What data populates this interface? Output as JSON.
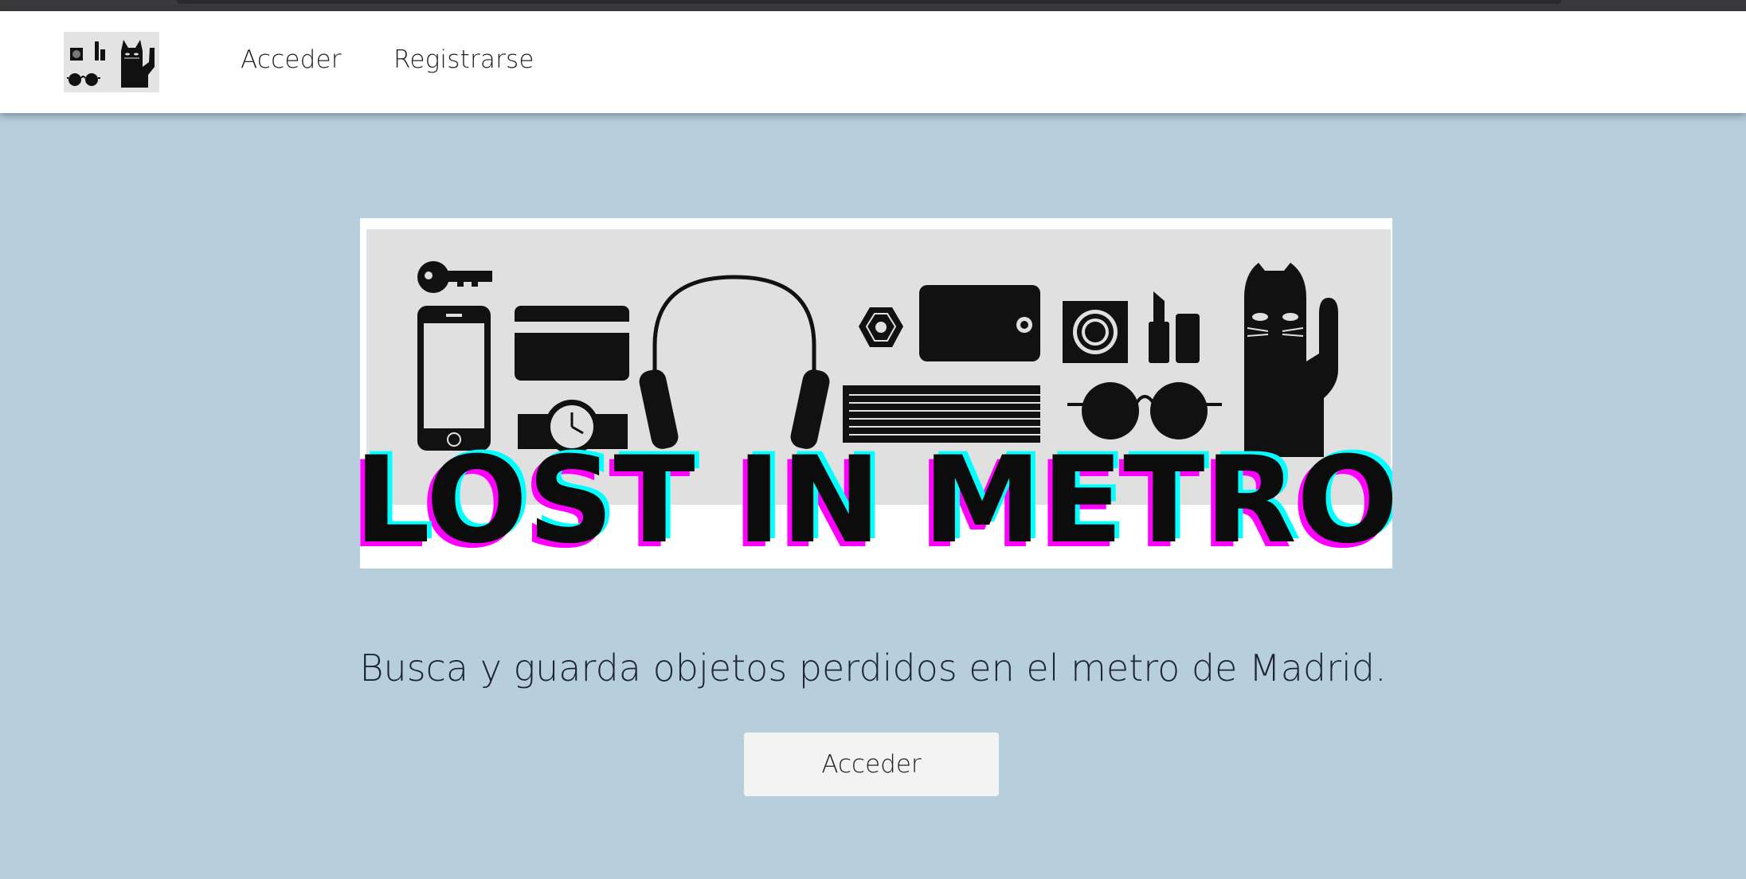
{
  "nav": {
    "logo_alt": "Lost in Metro logo",
    "links": [
      {
        "label": "Acceder"
      },
      {
        "label": "Registrarse"
      }
    ]
  },
  "hero": {
    "banner_title": "LOST IN METRO",
    "tagline": "Busca y guarda objetos perdidos en el metro de Madrid.",
    "cta_label": "Acceder"
  },
  "colors": {
    "background": "#b7cfdc",
    "navbar": "#ffffff",
    "banner_bg": "#e0e0e0",
    "title_glow_magenta": "#ff00ff",
    "title_glow_cyan": "#00ffff",
    "button_bg": "#f3f3f4"
  },
  "icons": [
    "key-icon",
    "phone-icon",
    "card-icon",
    "watch-icon",
    "headphones-icon",
    "gem-icon",
    "wallet-icon",
    "book-icon",
    "coin-icon",
    "lipstick-icon",
    "sunglasses-icon",
    "lucky-cat-icon"
  ]
}
